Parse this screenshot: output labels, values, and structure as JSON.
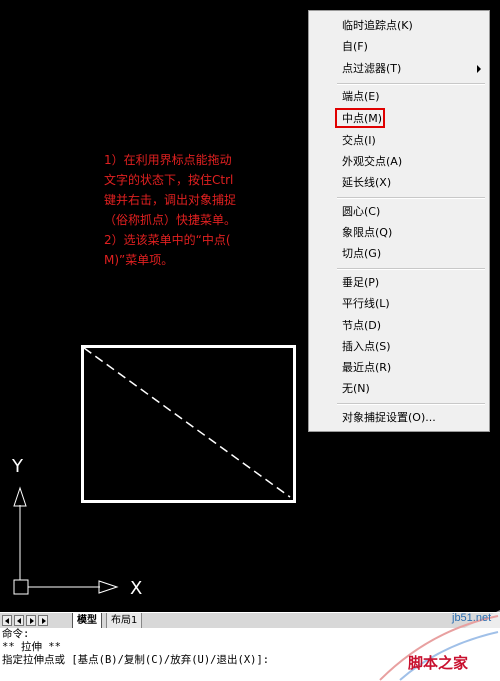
{
  "annotation": {
    "line1": "1）在利用界标点能拖动",
    "line2": "文字的状态下，按住Ctrl",
    "line3": "键并右击，调出对象捕捉",
    "line4": "（俗称抓点）快捷菜单。",
    "line5": "2）选该菜单中的“中点(",
    "line6": "M)”菜单项。"
  },
  "ucs": {
    "y_label": "Y",
    "x_label": "X"
  },
  "context_menu": {
    "items": [
      "临时追踪点(K)",
      "自(F)",
      "点过滤器(T)",
      "端点(E)",
      "中点(M)",
      "交点(I)",
      "外观交点(A)",
      "延长线(X)",
      "圆心(C)",
      "象限点(Q)",
      "切点(G)",
      "垂足(P)",
      "平行线(L)",
      "节点(D)",
      "插入点(S)",
      "最近点(R)",
      "无(N)",
      "对象捕捉设置(O)..."
    ],
    "highlighted": "中点(M)"
  },
  "tabs": {
    "model": "模型",
    "layout1": "布局1"
  },
  "command": {
    "line1": "命令:",
    "line2": "** 拉伸 **",
    "line3": "指定拉伸点或 [基点(B)/复制(C)/放弃(U)/退出(X)]:"
  },
  "watermark": {
    "url": "jb51.net",
    "name": "脚本之家"
  },
  "colors": {
    "highlight": "#e00000",
    "annotation": "#e02020",
    "canvas": "#000000"
  }
}
